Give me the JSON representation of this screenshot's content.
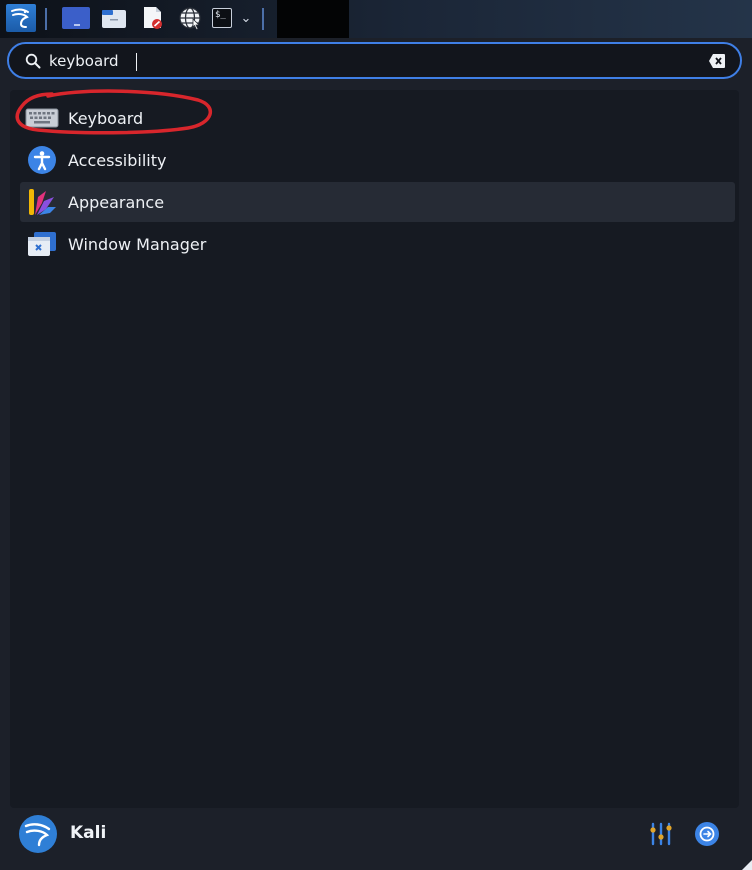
{
  "panel": {
    "launcher_icon": "kali-dragon-icon",
    "apps": [
      {
        "name": "show-desktop",
        "icon": "desktop-icon"
      },
      {
        "name": "file-manager",
        "icon": "folder-icon"
      },
      {
        "name": "text-editor",
        "icon": "text-editor-icon"
      },
      {
        "name": "web-browser",
        "icon": "globe-icon"
      },
      {
        "name": "terminal",
        "icon": "terminal-icon"
      }
    ],
    "terminal_glyph": "$_",
    "more_chevron": "⌄"
  },
  "search": {
    "value": "keyboard",
    "icon": "search-icon",
    "clear_icon": "clear-text-icon"
  },
  "results": [
    {
      "label": "Keyboard",
      "icon": "keyboard-icon"
    },
    {
      "label": "Accessibility",
      "icon": "accessibility-icon"
    },
    {
      "label": "Appearance",
      "icon": "appearance-icon"
    },
    {
      "label": "Window Manager",
      "icon": "window-manager-icon"
    }
  ],
  "footer": {
    "user_name": "Kali",
    "avatar_icon": "kali-dragon-avatar",
    "settings_icon": "settings-manager-icon",
    "logout_icon": "logout-icon"
  },
  "colors": {
    "panel_bg": "#0d1118",
    "menu_bg": "#1c2029",
    "results_bg": "#161a22",
    "accent": "#3f7fe6",
    "hover_row": "#262b35",
    "annotation": "#d8262c",
    "text": "#eef1f5"
  }
}
